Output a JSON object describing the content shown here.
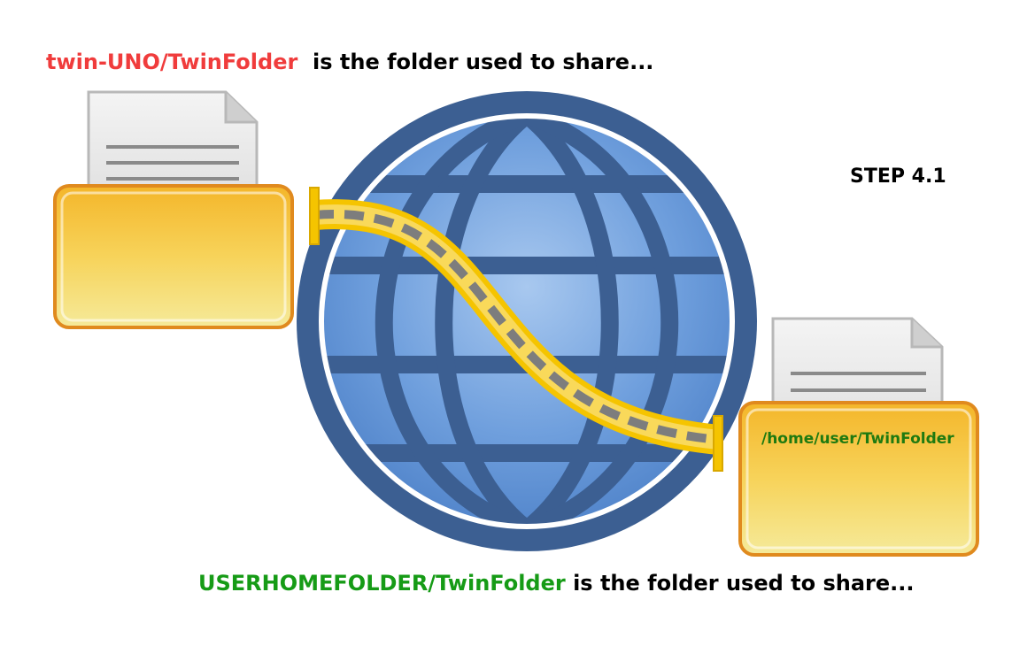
{
  "captions": {
    "top_path": "twin-UNO/TwinFolder",
    "top_rest": "is the folder used to share...",
    "bottom_path": "USERHOMEFOLDER/TwinFolder",
    "bottom_rest": "is the folder used to share..."
  },
  "step_label": "STEP 4.1",
  "right_folder_label": "/home/user/TwinFolder",
  "icons": {
    "left_folder": "folder-with-document-icon",
    "right_folder": "folder-with-document-icon",
    "globe": "globe-network-icon",
    "connection": "bridge-connection-icon"
  },
  "colors": {
    "top_path": "#f03c3c",
    "bottom_path": "#169b16",
    "folder_label": "#1f7a10",
    "globe_ring": "#3c5f92",
    "globe_panel": "#5e92d6",
    "bridge": "#f5c400",
    "bridge_dash": "#808080",
    "folder_body": "#f7cf46",
    "folder_border": "#e08a1e"
  }
}
